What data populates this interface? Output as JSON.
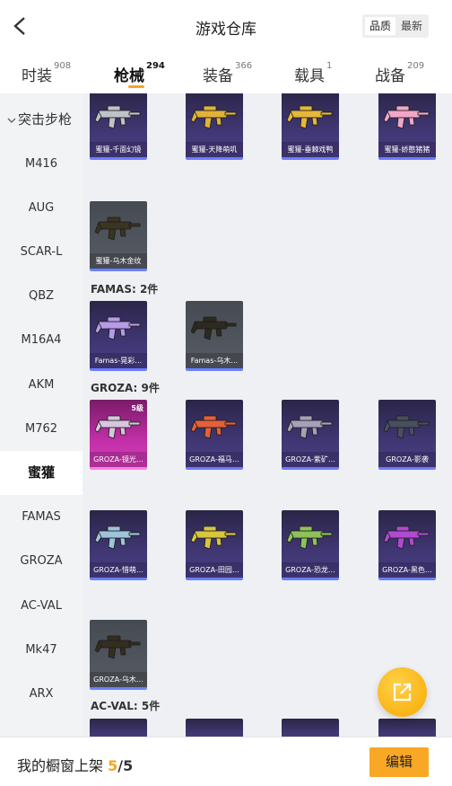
{
  "header": {
    "title": "游戏仓库",
    "sort_options": [
      "品质",
      "最新"
    ]
  },
  "tabs": [
    {
      "label": "时装",
      "count": "908"
    },
    {
      "label": "枪械",
      "count": "294"
    },
    {
      "label": "装备",
      "count": "366"
    },
    {
      "label": "载具",
      "count": "1"
    },
    {
      "label": "战备",
      "count": "209"
    }
  ],
  "sidebar": {
    "group": "突击步枪",
    "items": [
      "M416",
      "AUG",
      "SCAR-L",
      "QBZ",
      "M16A4",
      "AKM",
      "M762",
      "蜜獾",
      "FAMAS",
      "GROZA",
      "AC-VAL",
      "Mk47",
      "ARX"
    ]
  },
  "sections": [
    {
      "label": "FAMAS: 2件"
    },
    {
      "label": "GROZA: 9件"
    },
    {
      "label": "AC-VAL: 5件"
    }
  ],
  "cards": [
    {
      "name": "蜜獾-千面幻镜",
      "tier": "purple",
      "gun": "#bfc3c8"
    },
    {
      "name": "蜜獾-天降萌叽",
      "tier": "purple",
      "gun": "#e2b23a"
    },
    {
      "name": "蜜獾-垂棘戏鸭",
      "tier": "purple",
      "gun": "#e6b73b"
    },
    {
      "name": "蜜獾-娇憨猪猪",
      "tier": "purple",
      "gun": "#f1a6c8"
    },
    {
      "name": "蜜獾-乌木金纹",
      "tier": "grey",
      "gun": "#3a3520"
    },
    {
      "name": "Famas-晃彩…",
      "tier": "purple",
      "gun": "#b79ae8"
    },
    {
      "name": "Famas-乌木…",
      "tier": "grey",
      "gun": "#2d2a20"
    },
    {
      "name": "GROZA-镜光…",
      "tier": "pink",
      "gun": "#d8c6de",
      "level": "5级"
    },
    {
      "name": "GROZA-福马…",
      "tier": "purple",
      "gun": "#e2613a"
    },
    {
      "name": "GROZA-紫矿…",
      "tier": "purple",
      "gun": "#a8a0b8"
    },
    {
      "name": "GROZA-影袭",
      "tier": "purple",
      "gun": "#4a4f60"
    },
    {
      "name": "GROZA-惜萌…",
      "tier": "purple",
      "gun": "#9fc4d8"
    },
    {
      "name": "GROZA-田园…",
      "tier": "purple",
      "gun": "#d8c640"
    },
    {
      "name": "GROZA-恐龙…",
      "tier": "purple",
      "gun": "#8fc25a"
    },
    {
      "name": "GROZA-黑色…",
      "tier": "purple",
      "gun": "#b04ad0"
    },
    {
      "name": "GROZA-乌木…",
      "tier": "grey",
      "gun": "#332e20"
    }
  ],
  "bottom": {
    "label": "我的橱窗上架",
    "count": "5",
    "separator": "/",
    "total": "5",
    "edit_label": "编辑"
  },
  "colors": {
    "accent": "#f5a623",
    "purple_tier": "#3e3570",
    "grey_tier": "#575b63",
    "pink_tier": "#c22fa8"
  }
}
